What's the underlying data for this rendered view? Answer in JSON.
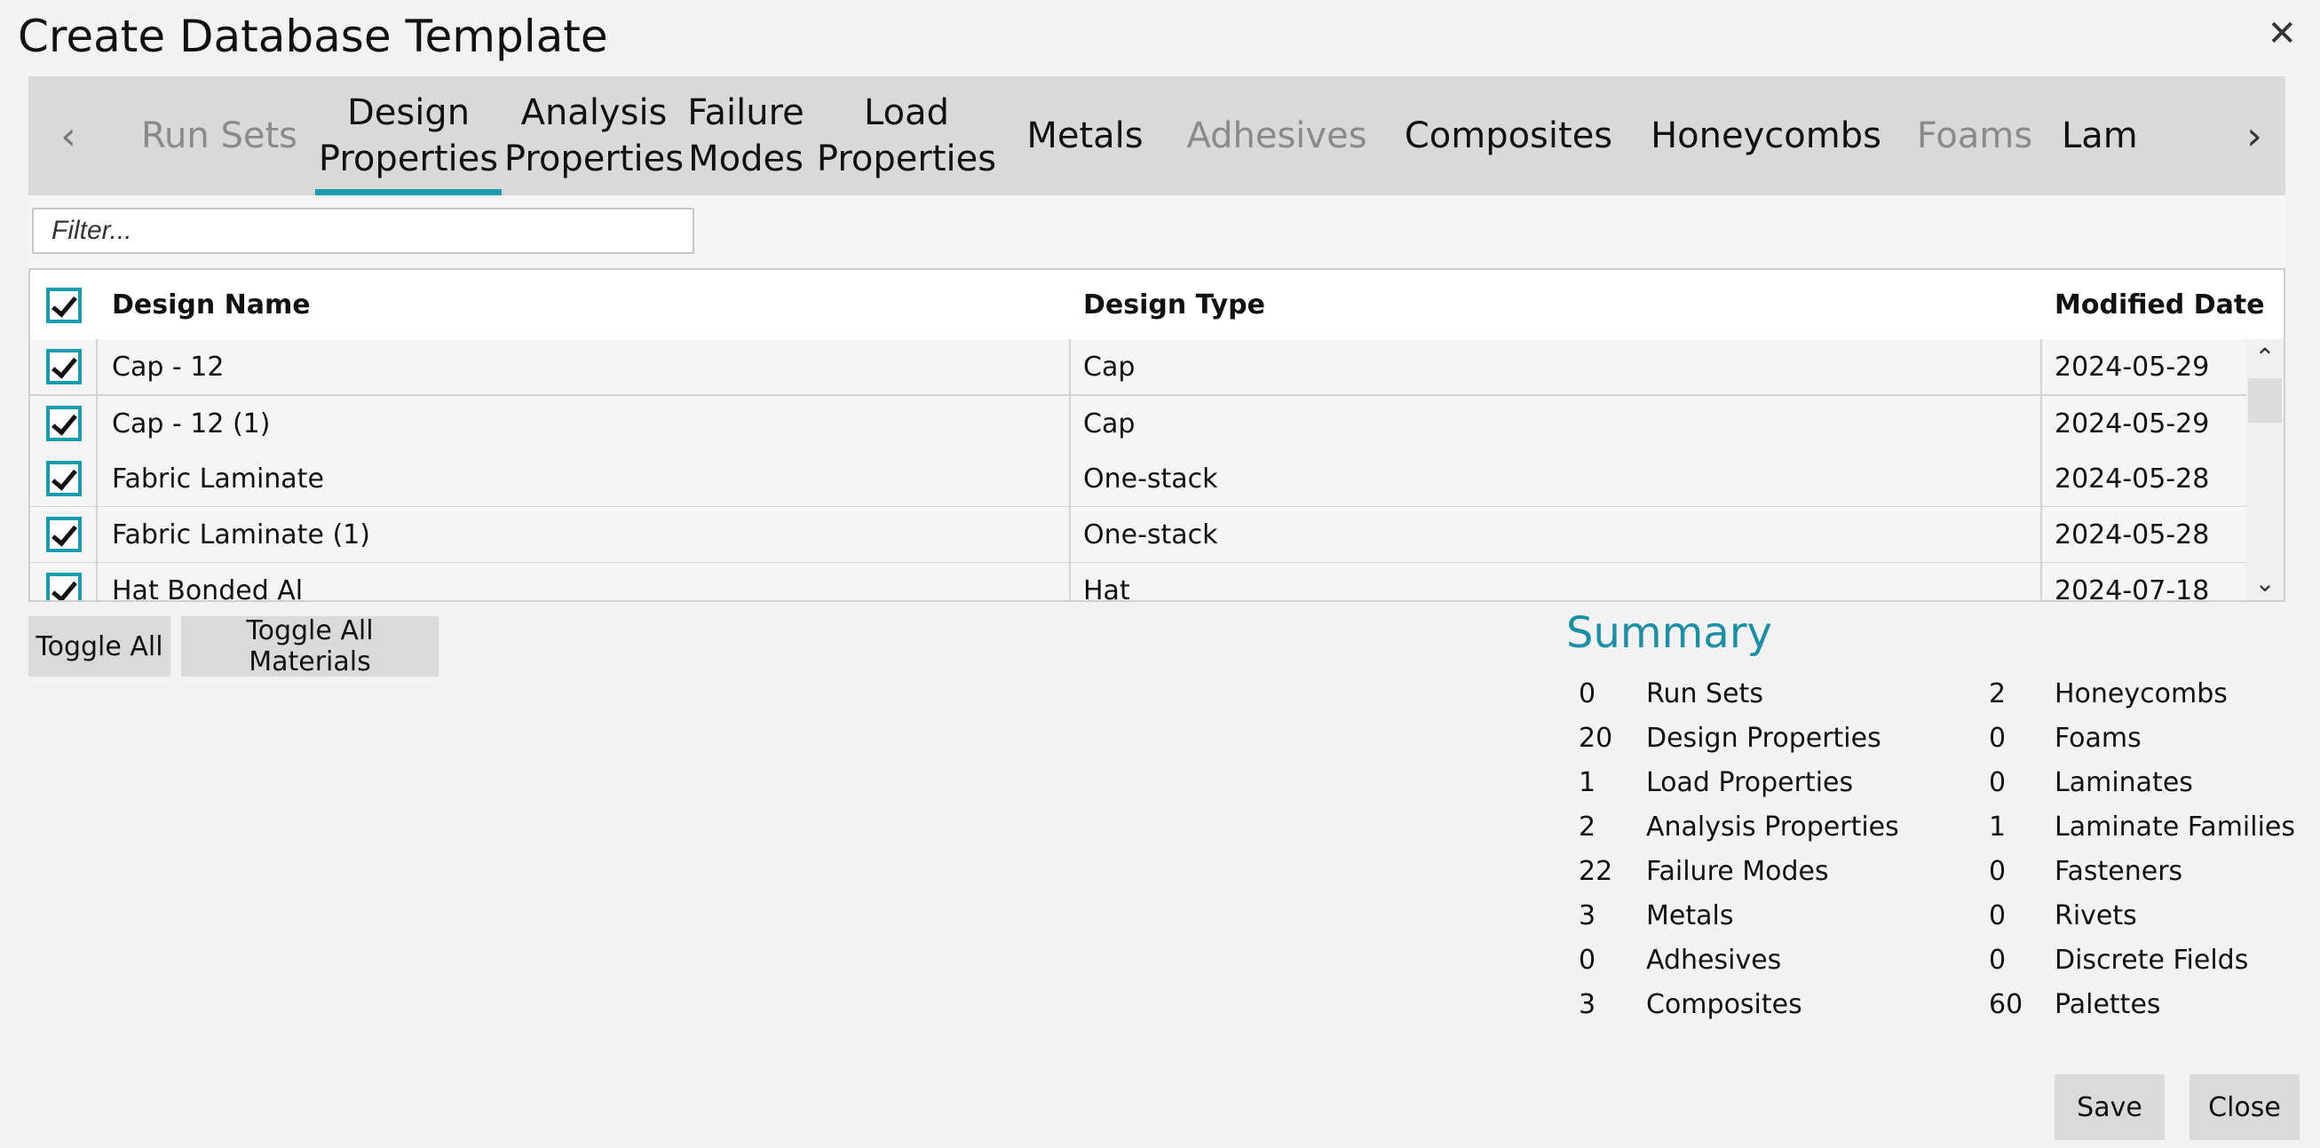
{
  "window": {
    "title": "Create Database Template",
    "close_glyph": "✕"
  },
  "tabs": [
    {
      "label": "Run Sets",
      "dim": true
    },
    {
      "label": "Design\nProperties",
      "active": true
    },
    {
      "label": "Analysis\nProperties"
    },
    {
      "label": "Failure\nModes"
    },
    {
      "label": "Load\nProperties"
    },
    {
      "label": "Metals"
    },
    {
      "label": "Adhesives",
      "dim": true
    },
    {
      "label": "Composites"
    },
    {
      "label": "Honeycombs"
    },
    {
      "label": "Foams",
      "dim": true
    },
    {
      "label": "Lam"
    }
  ],
  "filter": {
    "placeholder": "Filter..."
  },
  "grid": {
    "headers": {
      "name": "Design Name",
      "type": "Design Type",
      "date": "Modified Date"
    },
    "rows": [
      {
        "name": "Cap - 12",
        "type": "Cap",
        "date": "2024-05-29"
      },
      {
        "name": "Cap - 12 (1)",
        "type": "Cap",
        "date": "2024-05-29"
      },
      {
        "name": "Fabric Laminate",
        "type": "One-stack",
        "date": "2024-05-28"
      },
      {
        "name": "Fabric Laminate (1)",
        "type": "One-stack",
        "date": "2024-05-28"
      },
      {
        "name": "Hat Bonded Al",
        "type": "Hat",
        "date": "2024-07-18"
      }
    ]
  },
  "buttons": {
    "toggle_all": "Toggle All",
    "toggle_all_materials": "Toggle All Materials",
    "save": "Save",
    "close": "Close"
  },
  "summary": {
    "title": "Summary",
    "left": [
      {
        "count": "0",
        "label": "Run Sets"
      },
      {
        "count": "20",
        "label": "Design Properties"
      },
      {
        "count": "1",
        "label": "Load Properties"
      },
      {
        "count": "2",
        "label": "Analysis Properties"
      },
      {
        "count": "22",
        "label": "Failure Modes"
      },
      {
        "count": "3",
        "label": "Metals"
      },
      {
        "count": "0",
        "label": "Adhesives"
      },
      {
        "count": "3",
        "label": "Composites"
      }
    ],
    "right": [
      {
        "count": "2",
        "label": "Honeycombs"
      },
      {
        "count": "0",
        "label": "Foams"
      },
      {
        "count": "0",
        "label": "Laminates"
      },
      {
        "count": "1",
        "label": "Laminate Families"
      },
      {
        "count": "0",
        "label": "Fasteners"
      },
      {
        "count": "0",
        "label": "Rivets"
      },
      {
        "count": "0",
        "label": "Discrete Fields"
      },
      {
        "count": "60",
        "label": "Palettes"
      }
    ]
  },
  "colors": {
    "accent": "#1a9bb0",
    "summary_title": "#1a8fa6"
  }
}
